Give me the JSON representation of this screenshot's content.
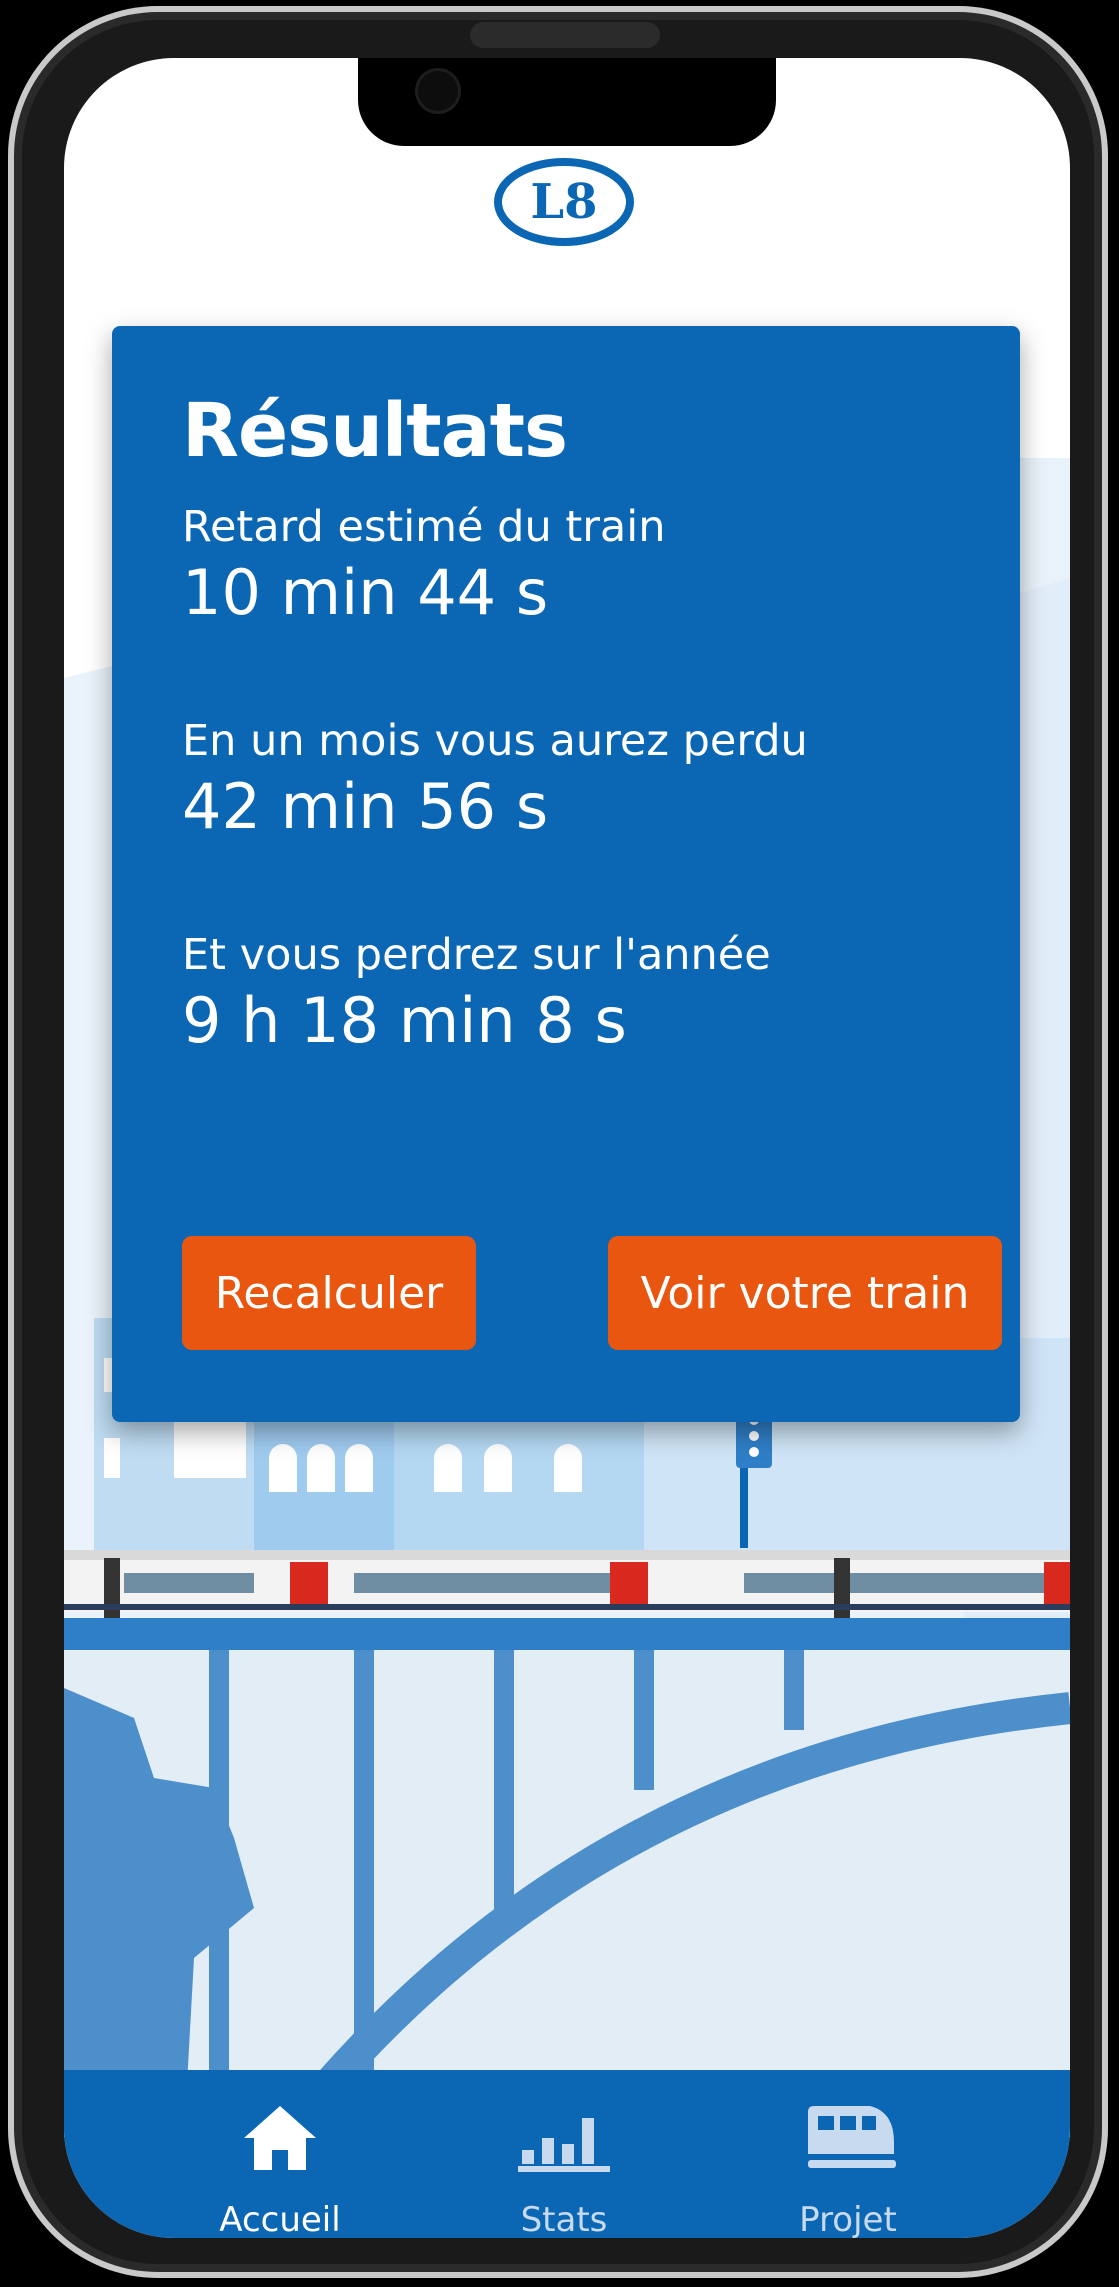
{
  "brand": {
    "logo_text": "L8",
    "color": "#0b67b3"
  },
  "card": {
    "title": "Résultats",
    "items": [
      {
        "label": "Retard estimé du train",
        "value": "10 min 44 s"
      },
      {
        "label": "En un mois vous aurez perdu",
        "value": "42 min 56 s"
      },
      {
        "label": "Et vous perdrez sur l'année",
        "value": "9 h 18 min 8 s"
      }
    ],
    "buttons": {
      "recalc": "Recalculer",
      "view_train": "Voir votre train"
    },
    "button_color": "#e8560f"
  },
  "nav": {
    "items": [
      {
        "label": "Accueil",
        "icon": "home-icon",
        "active": true
      },
      {
        "label": "Stats",
        "icon": "bar-chart-icon",
        "active": false
      },
      {
        "label": "Projet",
        "icon": "train-icon",
        "active": false
      }
    ]
  }
}
